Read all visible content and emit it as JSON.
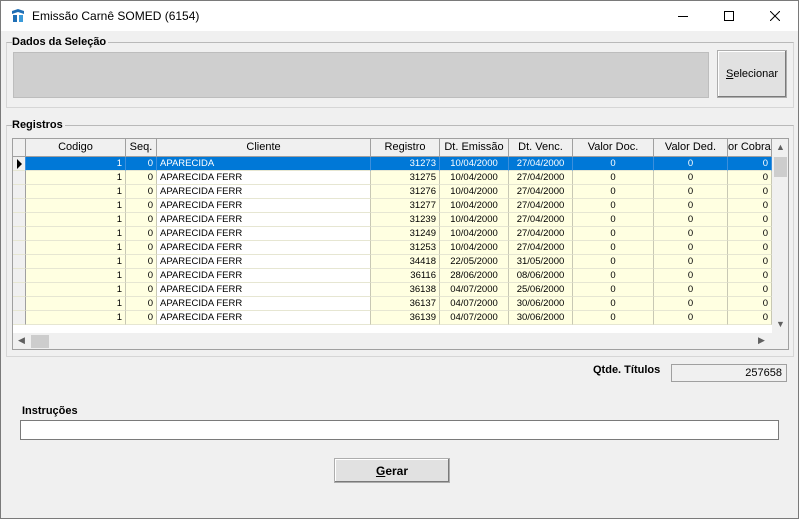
{
  "window": {
    "title": "Emissão Carnê SOMED (6154)"
  },
  "selection_group": {
    "label": "Dados da Seleção",
    "button_label": "Selecionar",
    "button_underline": "S"
  },
  "records_group": {
    "label": "Registros",
    "columns": [
      "Codigo",
      "Seq.",
      "Cliente",
      "Registro",
      "Dt. Emissão",
      "Dt. Venc.",
      "Valor Doc.",
      "Valor Ded.",
      "or Cobra"
    ],
    "rows": [
      {
        "codigo": "1",
        "seq": "0",
        "cliente": "APARECIDA",
        "registro": "31273",
        "emissao": "10/04/2000",
        "venc": "27/04/2000",
        "valor_doc": "0",
        "valor_ded": "0",
        "cobra": "0"
      },
      {
        "codigo": "1",
        "seq": "0",
        "cliente": "APARECIDA FERR",
        "registro": "31275",
        "emissao": "10/04/2000",
        "venc": "27/04/2000",
        "valor_doc": "0",
        "valor_ded": "0",
        "cobra": "0"
      },
      {
        "codigo": "1",
        "seq": "0",
        "cliente": "APARECIDA FERR",
        "registro": "31276",
        "emissao": "10/04/2000",
        "venc": "27/04/2000",
        "valor_doc": "0",
        "valor_ded": "0",
        "cobra": "0"
      },
      {
        "codigo": "1",
        "seq": "0",
        "cliente": "APARECIDA FERR",
        "registro": "31277",
        "emissao": "10/04/2000",
        "venc": "27/04/2000",
        "valor_doc": "0",
        "valor_ded": "0",
        "cobra": "0"
      },
      {
        "codigo": "1",
        "seq": "0",
        "cliente": "APARECIDA FERR",
        "registro": "31239",
        "emissao": "10/04/2000",
        "venc": "27/04/2000",
        "valor_doc": "0",
        "valor_ded": "0",
        "cobra": "0"
      },
      {
        "codigo": "1",
        "seq": "0",
        "cliente": "APARECIDA FERR",
        "registro": "31249",
        "emissao": "10/04/2000",
        "venc": "27/04/2000",
        "valor_doc": "0",
        "valor_ded": "0",
        "cobra": "0"
      },
      {
        "codigo": "1",
        "seq": "0",
        "cliente": "APARECIDA FERR",
        "registro": "31253",
        "emissao": "10/04/2000",
        "venc": "27/04/2000",
        "valor_doc": "0",
        "valor_ded": "0",
        "cobra": "0"
      },
      {
        "codigo": "1",
        "seq": "0",
        "cliente": "APARECIDA FERR",
        "registro": "34418",
        "emissao": "22/05/2000",
        "venc": "31/05/2000",
        "valor_doc": "0",
        "valor_ded": "0",
        "cobra": "0"
      },
      {
        "codigo": "1",
        "seq": "0",
        "cliente": "APARECIDA FERR",
        "registro": "36116",
        "emissao": "28/06/2000",
        "venc": "08/06/2000",
        "valor_doc": "0",
        "valor_ded": "0",
        "cobra": "0"
      },
      {
        "codigo": "1",
        "seq": "0",
        "cliente": "APARECIDA FERR",
        "registro": "36138",
        "emissao": "04/07/2000",
        "venc": "25/06/2000",
        "valor_doc": "0",
        "valor_ded": "0",
        "cobra": "0"
      },
      {
        "codigo": "1",
        "seq": "0",
        "cliente": "APARECIDA FERR",
        "registro": "36137",
        "emissao": "04/07/2000",
        "venc": "30/06/2000",
        "valor_doc": "0",
        "valor_ded": "0",
        "cobra": "0"
      },
      {
        "codigo": "1",
        "seq": "0",
        "cliente": "APARECIDA FERR",
        "registro": "36139",
        "emissao": "04/07/2000",
        "venc": "30/06/2000",
        "valor_doc": "0",
        "valor_ded": "0",
        "cobra": "0"
      }
    ]
  },
  "qtde": {
    "label": "Qtde. Títulos",
    "value": "257658"
  },
  "instrucoes": {
    "label": "Instruções",
    "value": ""
  },
  "gerar_button": {
    "label": "Gerar"
  },
  "colors": {
    "selected_row": "#0078d7",
    "row_background": "#ffffe1",
    "window_background": "#f0f0f0"
  },
  "icons": {
    "app": "app-logo-icon",
    "minimize": "minimize-icon",
    "maximize": "maximize-icon",
    "close": "close-icon",
    "row_indicator": "row-pointer-icon"
  }
}
